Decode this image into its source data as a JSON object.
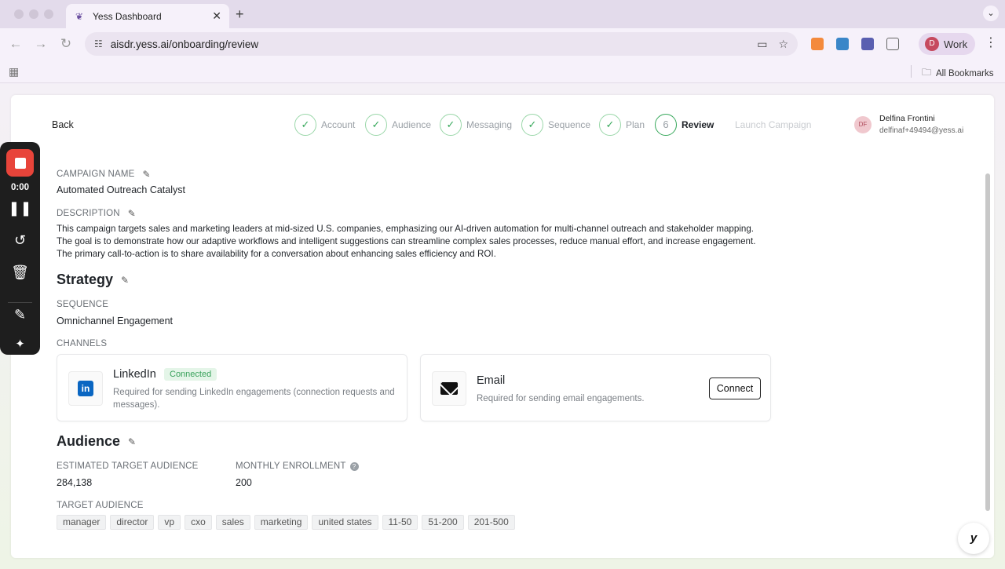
{
  "browser": {
    "tab_title": "Yess Dashboard",
    "url": "aisdr.yess.ai/onboarding/review",
    "profile_label": "Work",
    "profile_initial": "D",
    "bookmarks_label": "All Bookmarks"
  },
  "header": {
    "back_label": "Back",
    "steps": [
      {
        "label": "Account",
        "mark": "✓"
      },
      {
        "label": "Audience",
        "mark": "✓"
      },
      {
        "label": "Messaging",
        "mark": "✓"
      },
      {
        "label": "Sequence",
        "mark": "✓"
      },
      {
        "label": "Plan",
        "mark": "✓"
      },
      {
        "label": "Review",
        "mark": "6"
      }
    ],
    "launch_label": "Launch Campaign",
    "user": {
      "initials": "DF",
      "name": "Delfina Frontini",
      "email": "delfinaf+49494@yess.ai"
    }
  },
  "campaign": {
    "name_label": "CAMPAIGN NAME",
    "name": "Automated Outreach Catalyst",
    "description_label": "DESCRIPTION",
    "description": "This campaign targets sales and marketing leaders at mid-sized U.S. companies, emphasizing our AI-driven automation for multi-channel outreach and stakeholder mapping. The goal is to demonstrate how our adaptive workflows and intelligent suggestions can streamline complex sales processes, reduce manual effort, and increase engagement. The primary call-to-action is to share availability for a conversation about enhancing sales efficiency and ROI."
  },
  "strategy": {
    "heading": "Strategy",
    "sequence_label": "SEQUENCE",
    "sequence": "Omnichannel Engagement",
    "channels_label": "CHANNELS",
    "linkedin": {
      "name": "LinkedIn",
      "status": "Connected",
      "description": "Required for sending LinkedIn engagements (connection requests and messages)."
    },
    "email": {
      "name": "Email",
      "description": "Required for sending email engagements.",
      "button": "Connect"
    }
  },
  "audience": {
    "heading": "Audience",
    "estimated_label": "ESTIMATED TARGET AUDIENCE",
    "estimated": "284,138",
    "monthly_label": "MONTHLY ENROLLMENT",
    "monthly": "200",
    "target_label": "TARGET AUDIENCE",
    "tags": [
      "manager",
      "director",
      "vp",
      "cxo",
      "sales",
      "marketing",
      "united states",
      "11-50",
      "51-200",
      "201-500"
    ]
  },
  "recorder": {
    "time": "0:00"
  },
  "chat": {
    "label": "y"
  }
}
